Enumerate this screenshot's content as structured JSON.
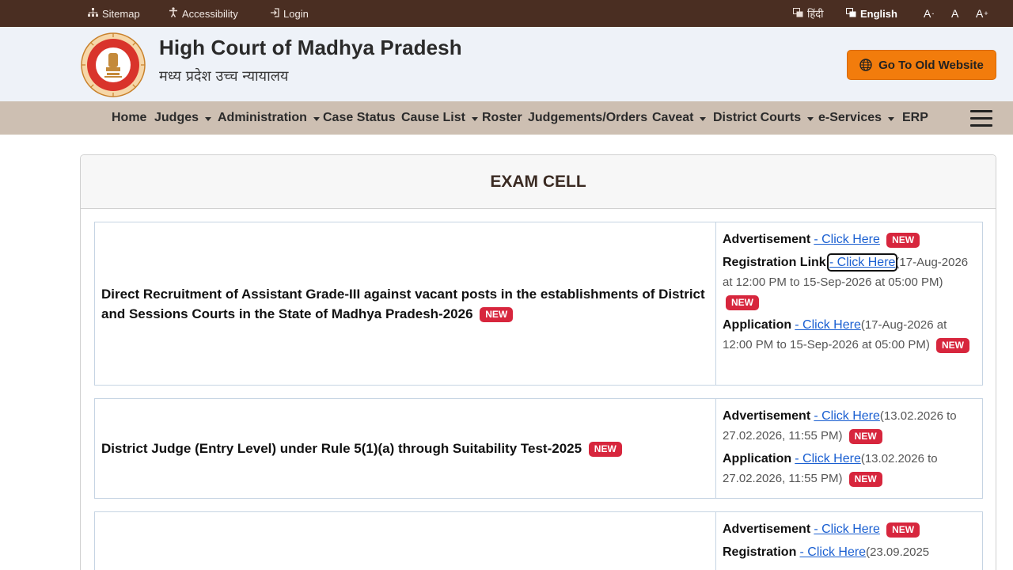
{
  "topbar": {
    "sitemap": "Sitemap",
    "accessibility": "Accessibility",
    "login": "Login",
    "hindi": "हिंदी",
    "english": "English",
    "font_decrease": "A",
    "font_normal": "A",
    "font_increase": "A",
    "font_decrease_sup": "-",
    "font_increase_sup": "+"
  },
  "header": {
    "title": "High Court of Madhya Pradesh",
    "subtitle": "मध्य प्रदेश उच्च न्यायालय",
    "old_site_button": "Go To Old Website"
  },
  "nav": {
    "items": [
      {
        "label": "Home",
        "dropdown": false
      },
      {
        "label": "Judges",
        "dropdown": true
      },
      {
        "label": "Administration",
        "dropdown": true
      },
      {
        "label": "Case Status",
        "dropdown": false
      },
      {
        "label": "Cause List",
        "dropdown": true
      },
      {
        "label": "Roster",
        "dropdown": false
      },
      {
        "label": "Judgements/Orders",
        "dropdown": false
      },
      {
        "label": "Caveat",
        "dropdown": true
      },
      {
        "label": "District Courts",
        "dropdown": true
      },
      {
        "label": "e-Services",
        "dropdown": true
      },
      {
        "label": "ERP",
        "dropdown": false
      }
    ]
  },
  "page": {
    "title": "EXAM CELL",
    "badge": "NEW"
  },
  "rows": [
    {
      "title": "Direct Recruitment of Assistant Grade-III against vacant posts in the establishments of District and Sessions Courts in the State of Madhya Pradesh-2026",
      "links": [
        {
          "label": "Advertisement",
          "link": "- Click Here",
          "dates": ""
        },
        {
          "label": "Registration Link",
          "link": "- Click Here",
          "dates": "(17-Aug-2026 at 12:00 PM to 15-Sep-2026 at 05:00 PM)"
        },
        {
          "label": "Application",
          "link": "- Click Here",
          "dates": "(17-Aug-2026 at 12:00 PM to 15-Sep-2026 at 05:00 PM)"
        }
      ]
    },
    {
      "title": "District Judge (Entry Level) under Rule 5(1)(a) through Suitability Test-2025",
      "links": [
        {
          "label": "Advertisement",
          "link": "- Click Here",
          "dates": "(13.02.2026 to 27.02.2026, 11:55 PM)"
        },
        {
          "label": "Application",
          "link": "- Click Here",
          "dates": "(13.02.2026 to 27.02.2026, 11:55 PM)"
        }
      ]
    },
    {
      "title": "",
      "links": [
        {
          "label": "Advertisement",
          "link": "- Click Here",
          "dates": ""
        },
        {
          "label": "Registration",
          "link": "- Click Here",
          "dates": "(23.09.2025"
        }
      ]
    }
  ],
  "colors": {
    "topbar": "#4a2e22",
    "header_bg": "#eef2f8",
    "nav_bg": "#cdbfb2",
    "old_button": "#f27c0c",
    "badge": "#d7263d",
    "link": "#1a5fd1"
  }
}
